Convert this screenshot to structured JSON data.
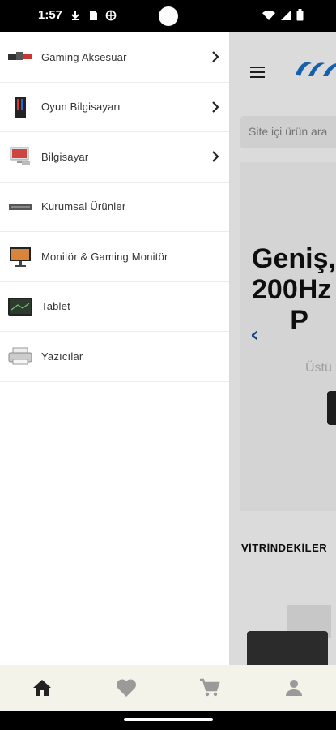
{
  "status_bar": {
    "time": "1:57",
    "left_icons": [
      "download-icon",
      "sim-card-icon",
      "vpn-globe-icon"
    ],
    "right_icons": [
      "wifi-icon",
      "signal-icon",
      "battery-icon"
    ]
  },
  "header": {
    "logo": "brand-logo"
  },
  "search": {
    "placeholder": "Site içi ürün ara"
  },
  "banner": {
    "title": "Geniş,\n200Hz\n     P",
    "subtitle": "Üstü"
  },
  "showcase": {
    "title": "VİTRİNDEKİLER"
  },
  "drawer": {
    "items": [
      {
        "label": "Gaming Aksesuar",
        "icon": "gaming-accessory-icon",
        "has_children": true
      },
      {
        "label": "Oyun Bilgisayarı",
        "icon": "gaming-pc-icon",
        "has_children": true
      },
      {
        "label": "Bilgisayar",
        "icon": "computer-icon",
        "has_children": true
      },
      {
        "label": "Kurumsal Ürünler",
        "icon": "corporate-products-icon",
        "has_children": false
      },
      {
        "label": "Monitör & Gaming Monitör",
        "icon": "monitor-icon",
        "has_children": false
      },
      {
        "label": "Tablet",
        "icon": "tablet-icon",
        "has_children": false
      },
      {
        "label": "Yazıcılar",
        "icon": "printer-icon",
        "has_children": false
      }
    ]
  },
  "bottom_nav": {
    "items": [
      {
        "icon": "home-icon",
        "active": true
      },
      {
        "icon": "heart-icon",
        "active": false
      },
      {
        "icon": "cart-icon",
        "active": false
      },
      {
        "icon": "profile-icon",
        "active": false
      }
    ]
  },
  "colors": {
    "accent": "#1a4f9c",
    "nav_bg": "#f3f3ea",
    "nav_active": "#222222",
    "nav_inactive": "#9a9a9a"
  }
}
